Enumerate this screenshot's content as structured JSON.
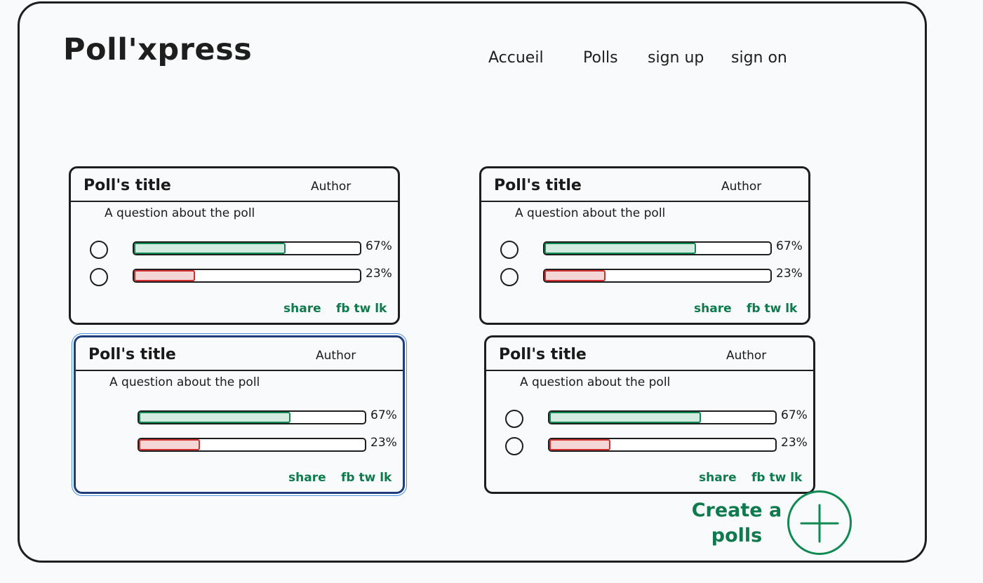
{
  "app": {
    "logo": "Poll'xpress"
  },
  "nav": [
    {
      "label": "Accueil"
    },
    {
      "label": "Polls"
    },
    {
      "label": "sign up"
    },
    {
      "label": "sign on"
    }
  ],
  "polls": [
    {
      "title": "Poll's title",
      "author": "Author",
      "question": "A question about the poll",
      "options": [
        {
          "value_label": "67%",
          "fill": 0.67,
          "color": "#0f8a53"
        },
        {
          "value_label": "23%",
          "fill": 0.27,
          "color": "#d32f2f"
        }
      ],
      "share_label": "share",
      "social_label": "fb tw lk",
      "show_radios": true
    },
    {
      "title": "Poll's title",
      "author": "Author",
      "question": "A question about the poll",
      "options": [
        {
          "value_label": "67%",
          "fill": 0.67,
          "color": "#0f8a53"
        },
        {
          "value_label": "23%",
          "fill": 0.27,
          "color": "#d32f2f"
        }
      ],
      "share_label": "share",
      "social_label": "fb tw lk",
      "show_radios": true
    },
    {
      "title": "Poll's title",
      "author": "Author",
      "question": "A question about the poll",
      "options": [
        {
          "value_label": "67%",
          "fill": 0.67,
          "color": "#0f8a53"
        },
        {
          "value_label": "23%",
          "fill": 0.27,
          "color": "#d32f2f"
        }
      ],
      "share_label": "share",
      "social_label": "fb tw lk",
      "show_radios": false
    },
    {
      "title": "Poll's title",
      "author": "Author",
      "question": "A question about the poll",
      "options": [
        {
          "value_label": "67%",
          "fill": 0.67,
          "color": "#0f8a53"
        },
        {
          "value_label": "23%",
          "fill": 0.27,
          "color": "#d32f2f"
        }
      ],
      "share_label": "share",
      "social_label": "fb tw lk",
      "show_radios": true
    }
  ],
  "create": {
    "label_line1": "Create a",
    "label_line2": "polls",
    "icon": "plus-icon"
  },
  "colors": {
    "accent": "#0f7a4d",
    "yes": "#0f8a53",
    "no": "#d32f2f"
  }
}
